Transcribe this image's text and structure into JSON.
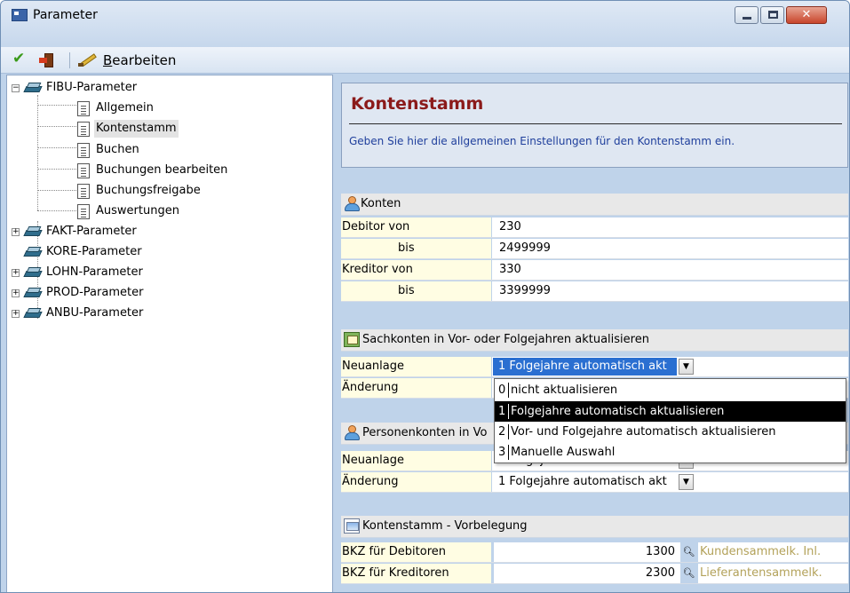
{
  "window": {
    "title": "Parameter"
  },
  "toolbar": {
    "edit_label": "Bearbeiten"
  },
  "tree": {
    "items": [
      {
        "label": "FIBU-Parameter",
        "level": 0,
        "expander": "−",
        "icon": "book-icon"
      },
      {
        "label": "Allgemein",
        "level": 1,
        "icon": "document-icon"
      },
      {
        "label": "Kontenstamm",
        "level": 1,
        "icon": "document-icon",
        "selected": true
      },
      {
        "label": "Buchen",
        "level": 1,
        "icon": "document-icon"
      },
      {
        "label": "Buchungen bearbeiten",
        "level": 1,
        "icon": "document-icon"
      },
      {
        "label": "Buchungsfreigabe",
        "level": 1,
        "icon": "document-icon"
      },
      {
        "label": "Auswertungen",
        "level": 1,
        "icon": "document-icon"
      },
      {
        "label": "FAKT-Parameter",
        "level": 0,
        "expander": "+",
        "icon": "book-icon"
      },
      {
        "label": "KORE-Parameter",
        "level": 0,
        "icon": "book-icon"
      },
      {
        "label": "LOHN-Parameter",
        "level": 0,
        "expander": "+",
        "icon": "book-icon"
      },
      {
        "label": "PROD-Parameter",
        "level": 0,
        "expander": "+",
        "icon": "book-icon"
      },
      {
        "label": "ANBU-Parameter",
        "level": 0,
        "expander": "+",
        "icon": "book-icon"
      }
    ]
  },
  "header": {
    "title": "Kontenstamm",
    "description": "Geben Sie hier die allgemeinen Einstellungen für den Kontenstamm ein."
  },
  "konten": {
    "section_label": "Konten",
    "rows": [
      {
        "label": "Debitor  von",
        "value": "230"
      },
      {
        "label": "bis",
        "value": "2499999"
      },
      {
        "label": "Kreditor von",
        "value": "330"
      },
      {
        "label": "bis",
        "value": "3399999"
      }
    ]
  },
  "sachkonten": {
    "section_label": "Sachkonten in Vor- oder Folgejahren aktualisieren",
    "neuanlage_label": "Neuanlage",
    "neuanlage_value": "1 Folgejahre automatisch akt",
    "aenderung_label": "Änderung",
    "dropdown_open": true
  },
  "dropdown": {
    "options": [
      {
        "num": "0",
        "text": "nicht aktualisieren"
      },
      {
        "num": "1",
        "text": "Folgejahre automatisch aktualisieren",
        "highlighted": true
      },
      {
        "num": "2",
        "text": "Vor- und Folgejahre automatisch aktualisieren"
      },
      {
        "num": "3",
        "text": "Manuelle Auswahl"
      }
    ]
  },
  "personenkonten": {
    "section_label": "Personenkonten in Vo",
    "neuanlage_label": "Neuanlage",
    "neuanlage_value": "1 Folgejahre automatisch akt",
    "aenderung_label": "Änderung",
    "aenderung_value": "1 Folgejahre automatisch akt"
  },
  "vorbelegung": {
    "section_label": "Kontenstamm - Vorbelegung",
    "rows": [
      {
        "label": "BKZ für Debitoren",
        "value": "1300",
        "hint": "Kundensammelk. Inl."
      },
      {
        "label": "BKZ für Kreditoren",
        "value": "2300",
        "hint": "Lieferantensammelk."
      }
    ]
  },
  "colors": {
    "window_bg": "#bfd3ea",
    "header_title": "#8b1a1a",
    "header_desc": "#1f3f9c",
    "label_bg": "#fffde3",
    "selection": "#2a6fd1",
    "hint_text": "#b3a25a"
  }
}
